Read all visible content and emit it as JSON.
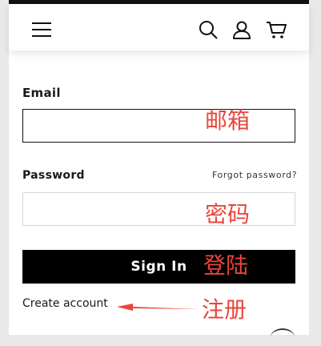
{
  "header": {
    "menu_icon": "hamburger-menu-icon",
    "search_icon": "search-icon",
    "account_icon": "user-icon",
    "cart_icon": "cart-icon"
  },
  "form": {
    "email_label": "Email",
    "email_value": "",
    "password_label": "Password",
    "password_value": "",
    "forgot_label": "Forgot password?",
    "signin_label": "Sign In",
    "create_account_label": "Create account"
  },
  "annotations": {
    "email": "邮箱",
    "password": "密码",
    "signin": "登陆",
    "register": "注册"
  },
  "colors": {
    "annotation": "#e8453c",
    "button_bg": "#000000",
    "button_text": "#ffffff"
  }
}
